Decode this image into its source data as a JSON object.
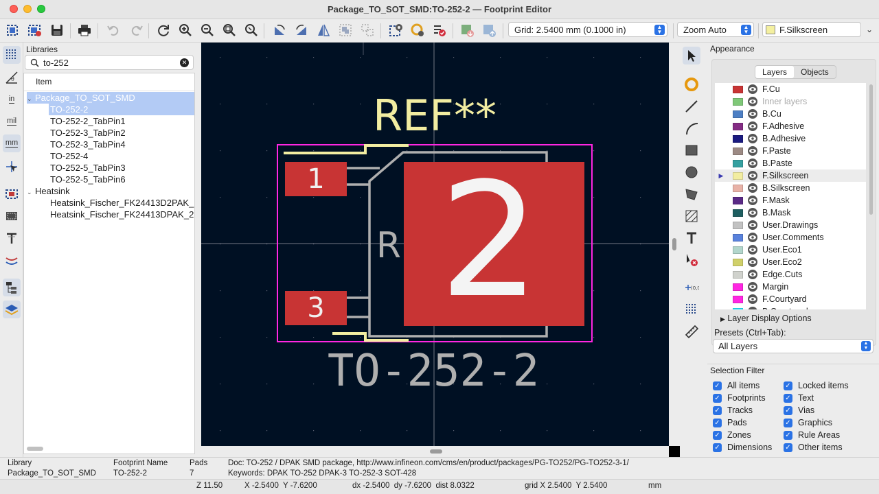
{
  "window": {
    "title": "Package_TO_SOT_SMD:TO-252-2 — Footprint Editor"
  },
  "toolbar": {
    "grid": "Grid: 2.5400 mm (0.1000 in)",
    "zoom": "Zoom Auto",
    "layer": "F.Silkscreen",
    "layer_color": "#f4f0a0",
    "icons": [
      "new-footprint-icon",
      "new-library-icon",
      "save-icon",
      "print-icon",
      "undo-icon",
      "redo-icon",
      "refresh-icon",
      "zoom-in-icon",
      "zoom-out-icon",
      "zoom-fit-icon",
      "zoom-selection-icon",
      "rotate-ccw-icon",
      "rotate-cw-icon",
      "mirror-icon",
      "group-icon",
      "ungroup-icon",
      "footprint-properties-icon",
      "pad-settings-icon",
      "drc-icon",
      "load-from-board-icon",
      "insert-into-board-icon"
    ]
  },
  "left_tools": {
    "units": [
      "in",
      "mil",
      "mm"
    ],
    "active_unit": "mm"
  },
  "libraries": {
    "header": "Libraries",
    "search": "to-252",
    "column": "Item",
    "tree": [
      {
        "kind": "lib",
        "label": "Package_TO_SOT_SMD",
        "selected": true
      },
      {
        "kind": "item",
        "label": "TO-252-2",
        "selected": true
      },
      {
        "kind": "item",
        "label": "TO-252-2_TabPin1"
      },
      {
        "kind": "item",
        "label": "TO-252-3_TabPin2"
      },
      {
        "kind": "item",
        "label": "TO-252-3_TabPin4"
      },
      {
        "kind": "item",
        "label": "TO-252-4"
      },
      {
        "kind": "item",
        "label": "TO-252-5_TabPin3"
      },
      {
        "kind": "item",
        "label": "TO-252-5_TabPin6"
      },
      {
        "kind": "lib",
        "label": "Heatsink"
      },
      {
        "kind": "item",
        "label": "Heatsink_Fischer_FK24413D2PAK_"
      },
      {
        "kind": "item",
        "label": "Heatsink_Fischer_FK24413DPAK_2"
      }
    ]
  },
  "canvas": {
    "reference": "REF**",
    "value": "TO-252-2",
    "pad1": "1",
    "pad2": "2",
    "pad3": "3",
    "fab_ref": "R",
    "colors": {
      "background": "#001023",
      "pad": "#c83434",
      "silkscreen": "#f2eda1",
      "fab": "#afafaf",
      "courtyard": "#ff26e2"
    }
  },
  "appearance": {
    "title": "Appearance",
    "tabs": [
      "Layers",
      "Objects"
    ],
    "active_tab": "Layers",
    "layers": [
      {
        "name": "F.Cu",
        "color": "#c83434"
      },
      {
        "name": "Inner layers",
        "color": "#7fc878",
        "dim": true
      },
      {
        "name": "B.Cu",
        "color": "#4d7fc4"
      },
      {
        "name": "F.Adhesive",
        "color": "#842c84"
      },
      {
        "name": "B.Adhesive",
        "color": "#1a1a80"
      },
      {
        "name": "F.Paste",
        "color": "#9c8a84"
      },
      {
        "name": "B.Paste",
        "color": "#35a0a0"
      },
      {
        "name": "F.Silkscreen",
        "color": "#f2eda1",
        "current": true
      },
      {
        "name": "B.Silkscreen",
        "color": "#e8b2a7"
      },
      {
        "name": "F.Mask",
        "color": "#5a2a86"
      },
      {
        "name": "B.Mask",
        "color": "#1e5e60"
      },
      {
        "name": "User.Drawings",
        "color": "#c2c2c2"
      },
      {
        "name": "User.Comments",
        "color": "#5982dc"
      },
      {
        "name": "User.Eco1",
        "color": "#b2d6cc"
      },
      {
        "name": "User.Eco2",
        "color": "#d0d06a"
      },
      {
        "name": "Edge.Cuts",
        "color": "#d0d2cd"
      },
      {
        "name": "Margin",
        "color": "#ff26e2"
      },
      {
        "name": "F.Courtyard",
        "color": "#ff26e2"
      },
      {
        "name": "B.Courtyard",
        "color": "#26e9ff"
      }
    ],
    "layer_display_options": "Layer Display Options",
    "presets_label": "Presets (Ctrl+Tab):",
    "presets_value": "All Layers"
  },
  "selection_filter": {
    "title": "Selection Filter",
    "items": [
      {
        "label": "All items",
        "checked": true
      },
      {
        "label": "Locked items",
        "checked": true
      },
      {
        "label": "Footprints",
        "checked": true
      },
      {
        "label": "Text",
        "checked": true
      },
      {
        "label": "Tracks",
        "checked": true
      },
      {
        "label": "Vias",
        "checked": true
      },
      {
        "label": "Pads",
        "checked": true
      },
      {
        "label": "Graphics",
        "checked": true
      },
      {
        "label": "Zones",
        "checked": true
      },
      {
        "label": "Rule Areas",
        "checked": true
      },
      {
        "label": "Dimensions",
        "checked": true
      },
      {
        "label": "Other items",
        "checked": true
      }
    ]
  },
  "message_panel": {
    "library_label": "Library",
    "library_value": "Package_TO_SOT_SMD",
    "footprint_label": "Footprint Name",
    "footprint_value": "TO-252-2",
    "pads_label": "Pads",
    "pads_value": "7",
    "doc": "Doc: TO-252 / DPAK SMD package, http://www.infineon.com/cms/en/product/packages/PG-TO252/PG-TO252-3-1/",
    "keywords": "Keywords: DPAK TO-252 DPAK-3 TO-252-3 SOT-428"
  },
  "status": {
    "zoom": "Z 11.50",
    "cursor": "X -2.5400  Y -7.6200",
    "delta": "dx -2.5400  dy -7.6200  dist 8.0322",
    "grid": "grid X 2.5400  Y 2.5400",
    "units": "mm"
  }
}
